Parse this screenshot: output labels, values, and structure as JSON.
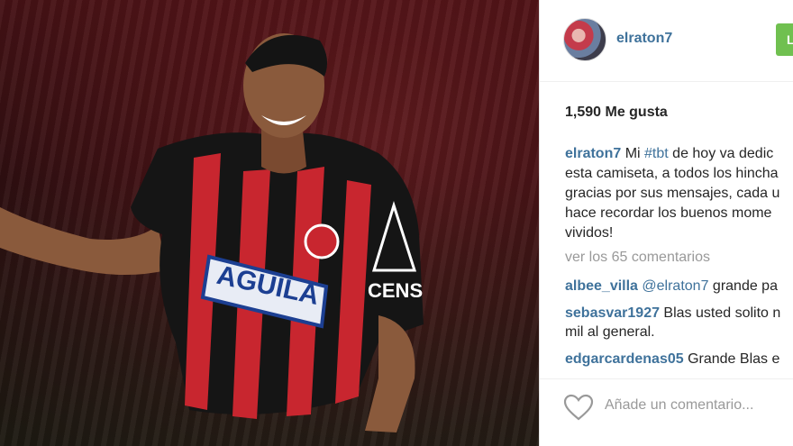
{
  "post": {
    "username": "elraton7",
    "follow_label": "L",
    "likes": "1,590 Me gusta",
    "caption_user": "elraton7",
    "caption_pre": " Mi ",
    "caption_hashtag": "#tbt",
    "caption_rest": " de hoy va dedic\nesta camiseta, a todos los hincha\ngracias por sus mensajes, cada u\nhace recordar los buenos mome\nvividos!",
    "view_comments": "ver los 65 comentarios",
    "comments": [
      {
        "user": "albee_villa",
        "mention": " @elraton7",
        "text": " grande pa"
      },
      {
        "user": "sebasvar1927",
        "mention": "",
        "text": " Blas usted solito n\nmil al general."
      },
      {
        "user": "edgarcardenas05",
        "mention": "",
        "text": " Grande Blas e"
      }
    ],
    "add_comment_placeholder": "Añade un comentario..."
  },
  "photo": {
    "jersey_sponsor": "AGUILA",
    "jersey_sponsor2": "CENS"
  },
  "colors": {
    "link": "#3f729b",
    "follow_button": "#70c050",
    "muted": "#999999"
  }
}
